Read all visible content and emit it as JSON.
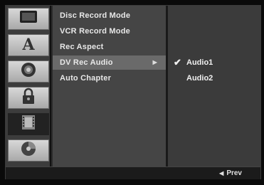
{
  "sidebar": {
    "tabs": [
      {
        "icon": "screen-icon"
      },
      {
        "icon": "language-a-icon"
      },
      {
        "icon": "speaker-icon"
      },
      {
        "icon": "lock-icon"
      },
      {
        "icon": "film-icon",
        "active": true
      },
      {
        "icon": "disc-icon"
      }
    ]
  },
  "menu": {
    "items": [
      {
        "label": "Disc Record Mode"
      },
      {
        "label": "VCR Record Mode"
      },
      {
        "label": "Rec Aspect"
      },
      {
        "label": "DV Rec Audio",
        "selected": true
      },
      {
        "label": "Auto Chapter"
      }
    ]
  },
  "options": {
    "items": [
      {
        "label": "Audio1",
        "checked": true
      },
      {
        "label": "Audio2",
        "checked": false
      }
    ]
  },
  "footer": {
    "prev_label": "Prev"
  }
}
